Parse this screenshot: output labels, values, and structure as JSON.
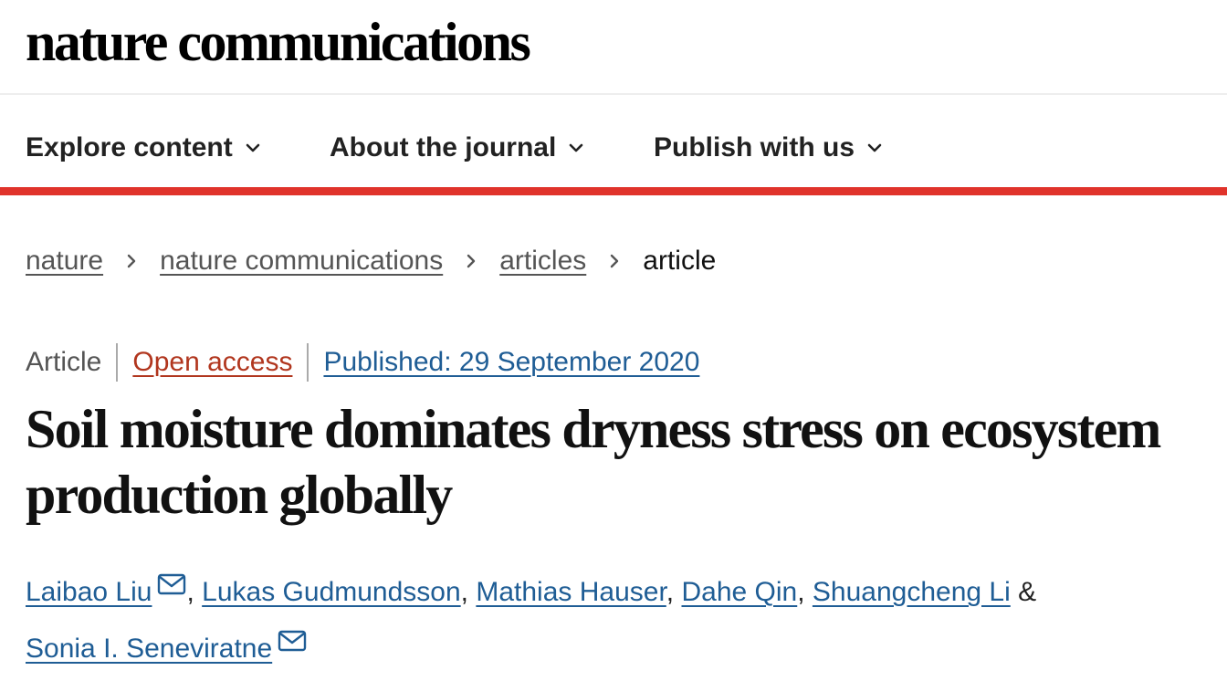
{
  "site": {
    "logo_text": "nature communications"
  },
  "nav": {
    "items": [
      {
        "label": "Explore content",
        "icon": "chevron-down-icon"
      },
      {
        "label": "About the journal",
        "icon": "chevron-down-icon"
      },
      {
        "label": "Publish with us",
        "icon": "chevron-down-icon"
      }
    ],
    "accent_color": "#e0332b"
  },
  "breadcrumb": {
    "links": [
      "nature",
      "nature communications",
      "articles"
    ],
    "current": "article",
    "separator_icon": "chevron-right-icon"
  },
  "article": {
    "type": "Article",
    "access": "Open access",
    "published": "Published: 29 September 2020",
    "title": "Soil moisture dominates dryness stress on ecosystem production globally",
    "authors": [
      {
        "name": "Laibao Liu",
        "corresponding": true
      },
      {
        "name": "Lukas Gudmundsson",
        "corresponding": false
      },
      {
        "name": "Mathias Hauser",
        "corresponding": false
      },
      {
        "name": "Dahe Qin",
        "corresponding": false
      },
      {
        "name": "Shuangcheng Li",
        "corresponding": false
      },
      {
        "name": "Sonia I. Seneviratne",
        "corresponding": true
      }
    ],
    "author_separator": ",",
    "author_last_joiner": "&",
    "mail_icon": "mail-icon"
  },
  "colors": {
    "link": "#1f5d95",
    "open_access": "#b1361e",
    "text": "#222222"
  }
}
